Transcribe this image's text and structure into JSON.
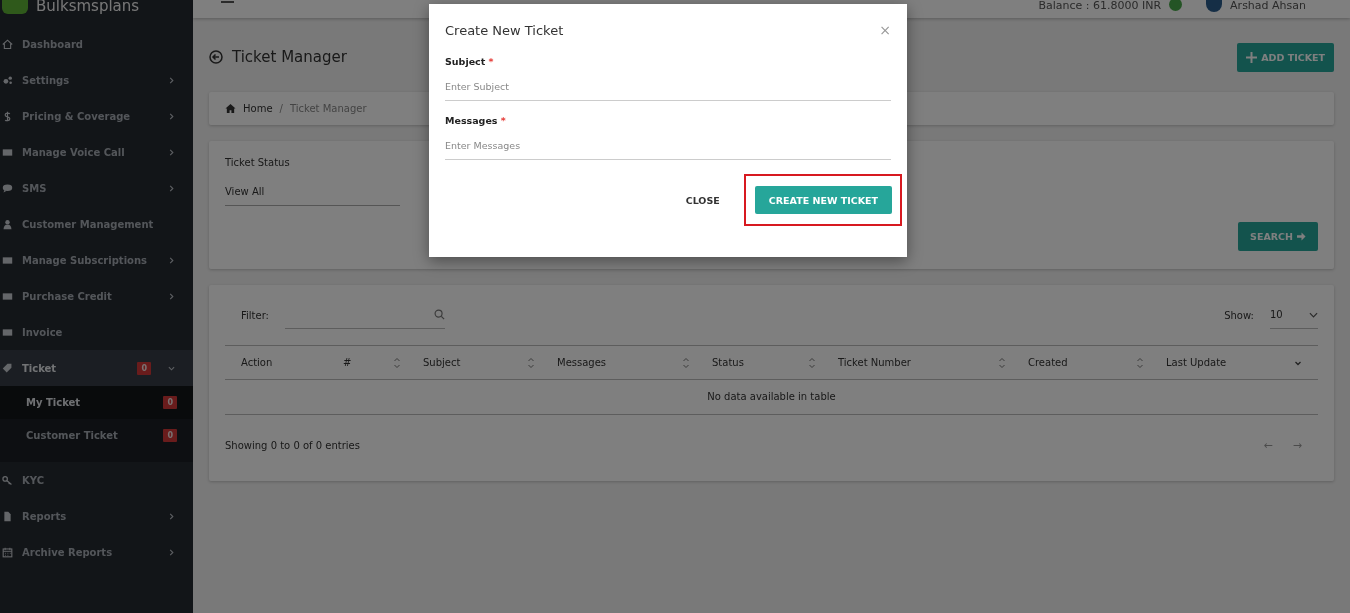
{
  "header": {
    "brand": "Bulksmsplans",
    "balance": "Balance : 61.8000 INR",
    "user": "Arshad Ahsan"
  },
  "sidebar": {
    "items": [
      {
        "label": "Dashboard",
        "has_arrow": false,
        "selected": false
      },
      {
        "label": "Settings",
        "has_arrow": true,
        "selected": false
      },
      {
        "label": "Pricing & Coverage",
        "has_arrow": true,
        "selected": false
      },
      {
        "label": "Manage Voice Call",
        "has_arrow": true,
        "selected": false
      },
      {
        "label": "SMS",
        "has_arrow": true,
        "selected": false
      },
      {
        "label": "Customer Management",
        "has_arrow": false,
        "selected": false
      },
      {
        "label": "Manage Subscriptions",
        "has_arrow": true,
        "selected": false
      },
      {
        "label": "Purchase Credit",
        "has_arrow": true,
        "selected": false
      },
      {
        "label": "Invoice",
        "has_arrow": false,
        "selected": false
      },
      {
        "label": "Ticket",
        "has_arrow": true,
        "selected": true,
        "expanded": true,
        "badge": "0",
        "children": [
          {
            "label": "My Ticket",
            "badge": "0",
            "selected": true
          },
          {
            "label": "Customer Ticket",
            "badge": "0",
            "selected": false
          }
        ]
      },
      {
        "label": "KYC",
        "has_arrow": false,
        "selected": false
      },
      {
        "label": "Reports",
        "has_arrow": true,
        "selected": false
      },
      {
        "label": "Archive Reports",
        "has_arrow": true,
        "selected": false
      }
    ]
  },
  "page": {
    "title": "Ticket Manager",
    "add_button": "ADD TICKET",
    "breadcrumb": [
      "Home",
      "Ticket Manager"
    ],
    "breadcrumb_separator": "/"
  },
  "filter": {
    "label": "Ticket Status",
    "value": "View All",
    "search_button": "SEARCH"
  },
  "table": {
    "filter_label": "Filter:",
    "show_label": "Show:",
    "show_value": "10",
    "columns": [
      {
        "label": "Action"
      },
      {
        "label": "#"
      },
      {
        "label": "Subject"
      },
      {
        "label": "Messages"
      },
      {
        "label": "Status"
      },
      {
        "label": "Ticket Number"
      },
      {
        "label": "Created"
      },
      {
        "label": "Last Update"
      }
    ],
    "empty": "No data available in table",
    "info": "Showing 0 to 0 of 0 entries",
    "prev": "←",
    "next": "→"
  },
  "modal": {
    "title": "Create New Ticket",
    "close_glyph": "×",
    "fields": [
      {
        "label": "Subject",
        "required_mark": "*",
        "placeholder": "Enter Subject"
      },
      {
        "label": "Messages",
        "required_mark": "*",
        "placeholder": "Enter Messages"
      }
    ],
    "buttons": [
      {
        "label": "CLOSE",
        "kind": "flat",
        "highlighted": false
      },
      {
        "label": "CREATE NEW TICKET",
        "kind": "primary",
        "highlighted": true
      }
    ]
  }
}
